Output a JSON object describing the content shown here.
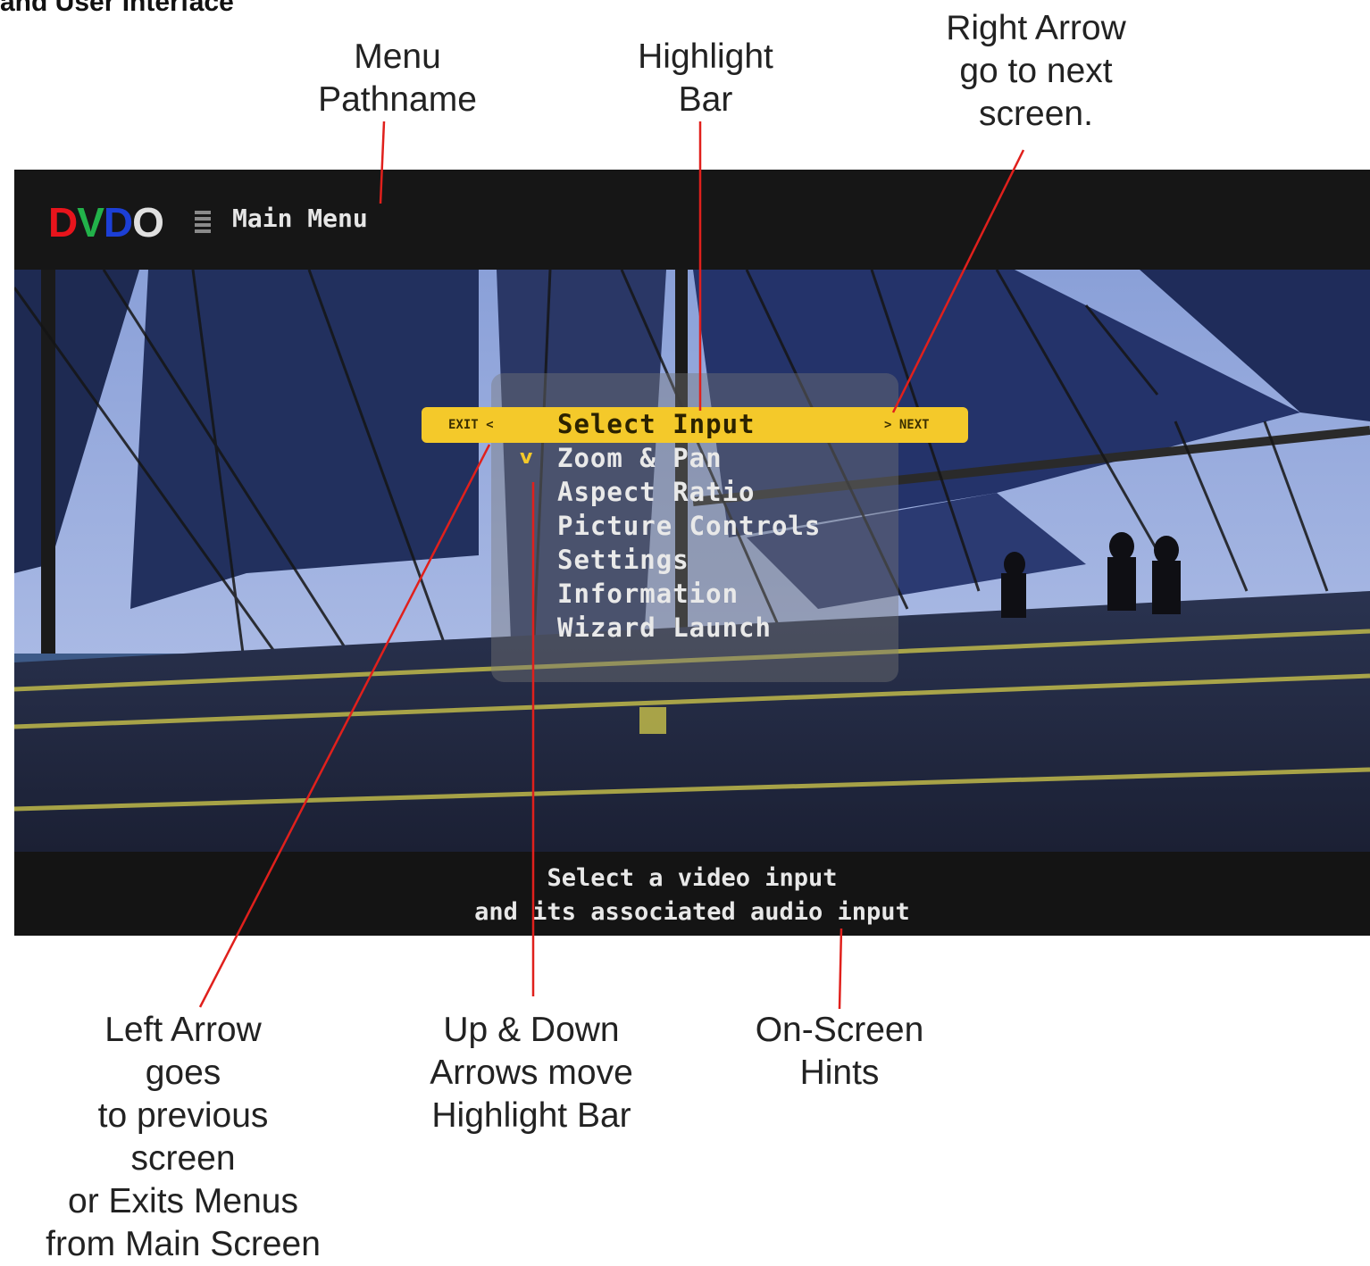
{
  "page": {
    "header_partial": "and User Interface"
  },
  "callouts": {
    "menu_pathname": "Menu\nPathname",
    "highlight_bar": "Highlight\nBar",
    "right_arrow": "Right Arrow\ngo to next\nscreen.",
    "left_arrow": "Left Arrow\ngoes\nto previous\nscreen\nor Exits Menus\nfrom Main Screen",
    "up_down": "Up &  Down\nArrows move\nHighlight Bar",
    "hints": "On-Screen\nHints"
  },
  "osd": {
    "logo_letters": [
      "D",
      "V",
      "D",
      "O"
    ],
    "logo_colors": [
      "#e8141c",
      "#22b24a",
      "#1c3fd6",
      "#e0e0e0"
    ],
    "pathname": "Main Menu",
    "menu_items": [
      "Select Input",
      "Zoom & Pan",
      "Aspect Ratio",
      "Picture Controls",
      "Settings",
      "Information",
      "Wizard Launch"
    ],
    "selected_index": 0,
    "exit_label": "EXIT <",
    "next_label": "> NEXT",
    "hint_lines": [
      "Select a video input",
      "and its associated audio input"
    ],
    "highlight_color": "#f4c92a",
    "callout_line_color": "#e0201c"
  }
}
